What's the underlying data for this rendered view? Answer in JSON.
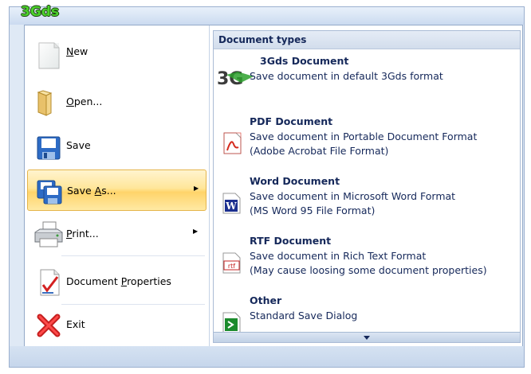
{
  "app": {
    "logo_text": "3Gds"
  },
  "left_menu": {
    "items": [
      {
        "label": "New",
        "icon": "new-document-icon",
        "has_submenu": false,
        "underline": "N"
      },
      {
        "label": "Open...",
        "icon": "open-folder-icon",
        "has_submenu": false,
        "underline": "O"
      },
      {
        "label": "Save",
        "icon": "save-floppy-icon",
        "has_submenu": false,
        "underline": ""
      },
      {
        "label": "Save As...",
        "icon": "save-as-icon",
        "has_submenu": true,
        "underline": "A",
        "highlighted": true
      },
      {
        "label": "Print...",
        "icon": "printer-icon",
        "has_submenu": true,
        "underline": "P"
      },
      {
        "label": "Document Properties",
        "icon": "document-properties-icon",
        "has_submenu": false,
        "underline": "P"
      },
      {
        "label": "Exit",
        "icon": "exit-x-icon",
        "has_submenu": false,
        "underline": ""
      }
    ]
  },
  "submenu": {
    "header": "Document types",
    "items": [
      {
        "title": "3Gds Document",
        "description": "Save document in default 3Gds format",
        "icon": "3g-logo-icon"
      },
      {
        "title": "PDF Document",
        "description": "Save document in Portable Document Format",
        "description2": "(Adobe Acrobat File Format)",
        "icon": "pdf-icon"
      },
      {
        "title": "Word Document",
        "description": "Save document in Microsoft Word Format",
        "description2": "(MS Word 95 File Format)",
        "icon": "word-icon"
      },
      {
        "title": "RTF Document",
        "description": "Save document in Rich Text Format",
        "description2": "(May cause loosing some document properties)",
        "icon": "rtf-icon"
      },
      {
        "title": "Other",
        "description": "Standard Save Dialog",
        "icon": "other-icon"
      }
    ]
  },
  "colors": {
    "highlight": "#ffd46a",
    "text": "#15285a",
    "frame_bg": "#dfe9f5"
  }
}
